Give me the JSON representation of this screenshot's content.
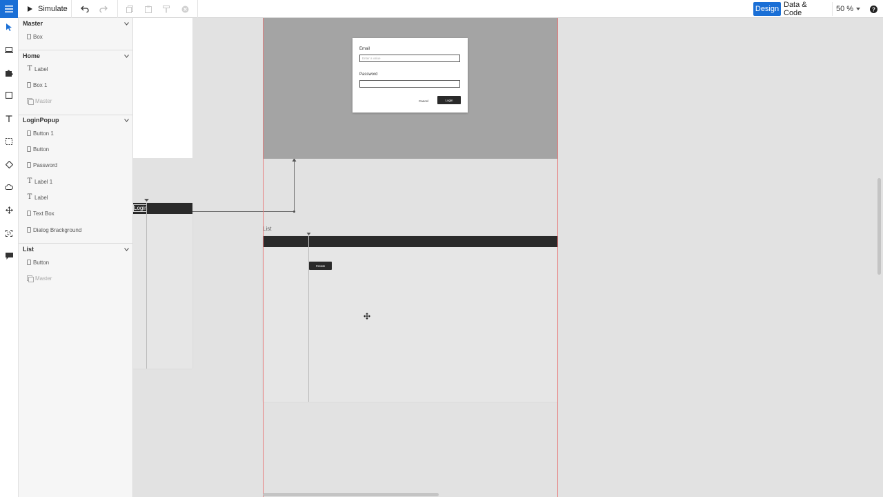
{
  "toolbar": {
    "simulate_label": "Simulate",
    "tabs": [
      {
        "label": "Design",
        "active": true
      },
      {
        "label": "Data & Code",
        "active": false
      }
    ],
    "zoom_label": "50 %",
    "help_icon": "question-icon",
    "accent_color": "#1a6fd6"
  },
  "layers": {
    "groups": [
      {
        "title": "Master",
        "items": [
          {
            "label": "Box",
            "icon": "box-icon",
            "dim": false
          }
        ]
      },
      {
        "title": "Home",
        "items": [
          {
            "label": "Label",
            "icon": "text-icon",
            "dim": false
          },
          {
            "label": "Box 1",
            "icon": "box-icon",
            "dim": false
          },
          {
            "label": "Master",
            "icon": "master-icon",
            "dim": true
          }
        ]
      },
      {
        "title": "LoginPopup",
        "items": [
          {
            "label": "Button 1",
            "icon": "box-icon",
            "dim": false
          },
          {
            "label": "Button",
            "icon": "box-icon",
            "dim": false
          },
          {
            "label": "Password",
            "icon": "box-icon",
            "dim": false
          },
          {
            "label": "Label 1",
            "icon": "text-icon",
            "dim": false
          },
          {
            "label": "Label",
            "icon": "text-icon",
            "dim": false
          },
          {
            "label": "Text Box",
            "icon": "box-icon",
            "dim": false
          },
          {
            "label": "Dialog Brackground",
            "icon": "box-icon",
            "dim": false
          }
        ]
      },
      {
        "title": "List",
        "items": [
          {
            "label": "Button",
            "icon": "box-icon",
            "dim": false
          },
          {
            "label": "Master",
            "icon": "master-icon",
            "dim": true
          }
        ]
      }
    ]
  },
  "canvas": {
    "dialog": {
      "email_label": "Email",
      "email_placeholder": "Enter a value",
      "password_label": "Password",
      "cancel_label": "Cancel",
      "login_label": "Login"
    },
    "left_frame_button_label": "Login",
    "list_frame_title": "List",
    "list_create_label": "Create"
  }
}
